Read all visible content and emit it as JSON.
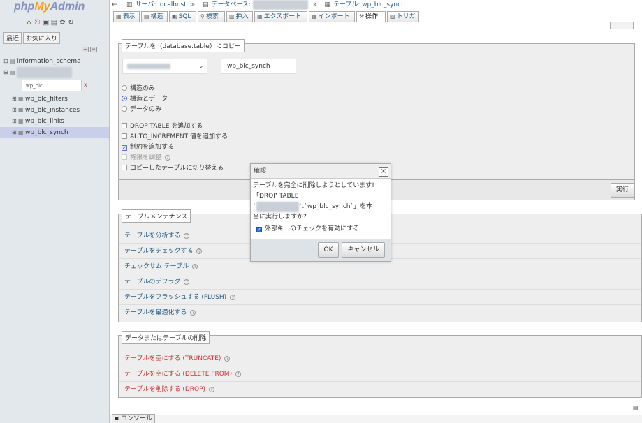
{
  "sidebar": {
    "logo": {
      "php": "php",
      "my": "My",
      "admin": "Admin"
    },
    "icons": [
      "home-icon",
      "exit-icon",
      "query-icon",
      "docs-icon",
      "settings-icon",
      "reload-icon"
    ],
    "tabs": {
      "recent": "最近",
      "favorites": "お気に入り"
    },
    "tree": {
      "db1": "information_schema",
      "db2": "xxxxxxxxxx_xxxx",
      "filter_value": "wp_blc",
      "filter_clear": "x",
      "tables": [
        "wp_blc_filters",
        "wp_blc_instances",
        "wp_blc_links",
        "wp_blc_synch"
      ]
    }
  },
  "breadcrumb": {
    "server_label": "サーバ: localhost",
    "database_label": "データベース:",
    "database_name": "xxxxxxxxxx_xxxx",
    "table_label": "テーブル: wp_blc_synch"
  },
  "menu": {
    "tabs": [
      "表示",
      "構造",
      "SQL",
      "検索",
      "挿入",
      "エクスポート",
      "インポート",
      "操作",
      "トリガ"
    ]
  },
  "copy_panel": {
    "legend": "テーブルを（database.table）にコピー",
    "db_select_value": "xxxxxxxxxx_xxxx",
    "dot": ".",
    "table_name_value": "wp_blc_synch",
    "radio_structure_only": "構造のみ",
    "radio_structure_data": "構造とデータ",
    "radio_data_only": "データのみ",
    "chk_drop_table": "DROP TABLE を追加する",
    "chk_auto_increment": "AUTO_INCREMENT 値を追加する",
    "chk_constraints": "制約を追加する",
    "chk_privileges": "権限を調整",
    "chk_switch": "コピーしたテーブルに切り替える",
    "execute": "実行",
    "help_mark": "?"
  },
  "maintenance": {
    "legend": "テーブルメンテナンス",
    "links": [
      "テーブルを分析する",
      "テーブルをチェックする",
      "チェックサム テーブル",
      "テーブルのデフラグ",
      "テーブルをフラッシュする (FLUSH)",
      "テーブルを最適化する"
    ]
  },
  "delete_panel": {
    "legend": "データまたはテーブルの削除",
    "links": [
      "テーブルを空にする (TRUNCATE)",
      "テーブルを空にする (DELETE FROM)",
      "テーブルを削除する (DROP)"
    ]
  },
  "dialog": {
    "title": "確認",
    "line1": "テーブルを完全に削除しようとしています!",
    "line2": "「DROP TABLE",
    "line3_pre": "`",
    "line3_db": "xxxxxxxxxx_xxxx",
    "line3_post": "`.`wp_blc_synch`」を本",
    "line4": "当に実行しますか?",
    "fk_check": "外部キーのチェックを有効にする",
    "ok": "OK",
    "cancel": "キャンセル",
    "close": "×"
  },
  "console": {
    "label": "コンソール"
  }
}
